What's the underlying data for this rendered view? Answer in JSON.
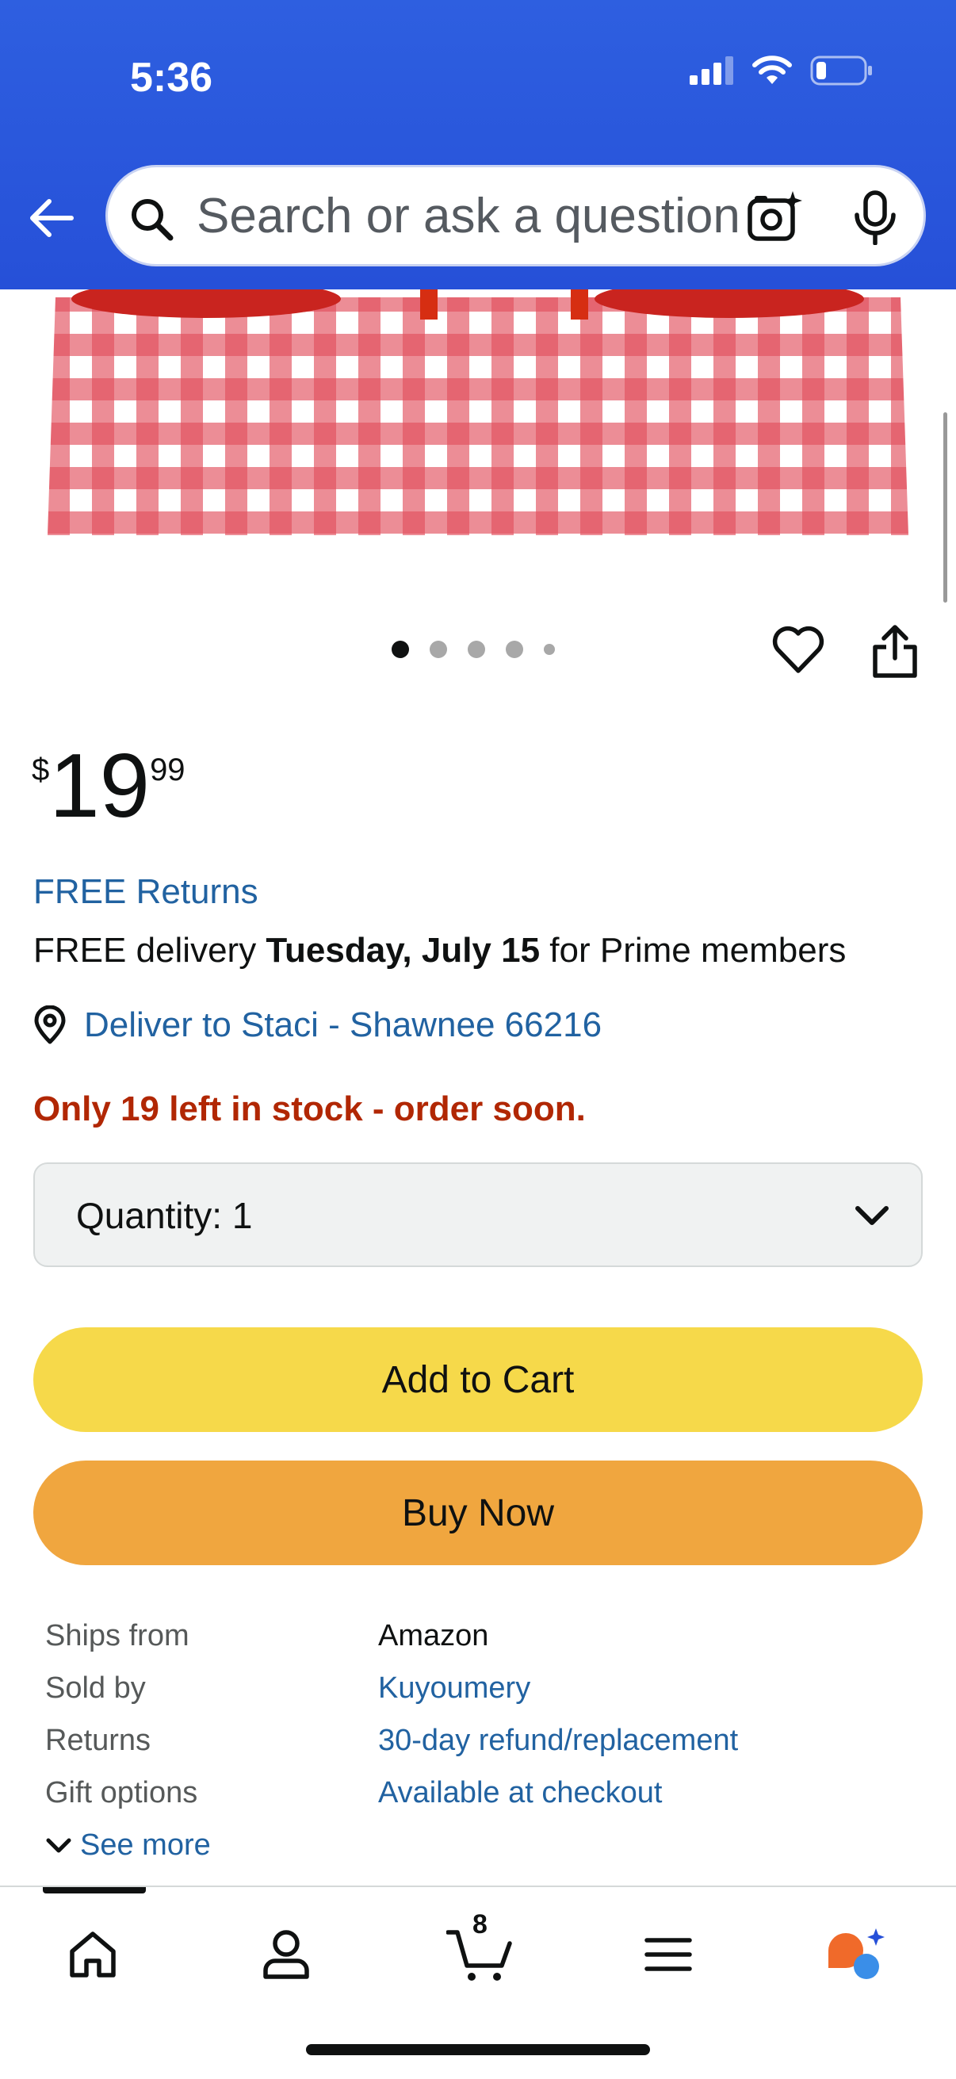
{
  "status_bar": {
    "time": "5:36"
  },
  "search": {
    "placeholder": "Search or ask a question"
  },
  "gallery": {
    "image_count": 5,
    "active_index": 0
  },
  "price": {
    "symbol": "$",
    "whole": "19",
    "fraction": "99"
  },
  "free_returns": "FREE Returns",
  "delivery": {
    "prefix": "FREE delivery ",
    "date": "Tuesday, July 15",
    "suffix": " for Prime members"
  },
  "deliver_to": "Deliver to Staci - Shawnee 66216",
  "stock_message": "Only 19 left in stock - order soon.",
  "quantity": {
    "label": "Quantity:",
    "value": "1"
  },
  "buttons": {
    "add_to_cart": "Add to Cart",
    "buy_now": "Buy Now"
  },
  "info_rows": [
    {
      "key": "Ships from",
      "value": "Amazon"
    },
    {
      "key": "Sold by",
      "value": "Kuyoumery"
    },
    {
      "key": "Returns",
      "value": "30-day refund/replacement"
    },
    {
      "key": "Gift options",
      "value": "Available at checkout"
    }
  ],
  "see_more": "See more",
  "bottom_nav": {
    "cart_count": "8"
  },
  "colors": {
    "header_blue": "#2650d8",
    "link_blue": "#2162a1",
    "stock_red": "#b12704",
    "cart_yellow": "#f6d94a",
    "buy_orange": "#f0a63f"
  },
  "icons": [
    "back-arrow-icon",
    "search-icon",
    "camera-icon",
    "mic-icon",
    "heart-icon",
    "share-icon",
    "location-pin-icon",
    "chevron-down-icon",
    "home-icon",
    "account-icon",
    "cart-icon",
    "menu-icon",
    "rufus-icon"
  ]
}
